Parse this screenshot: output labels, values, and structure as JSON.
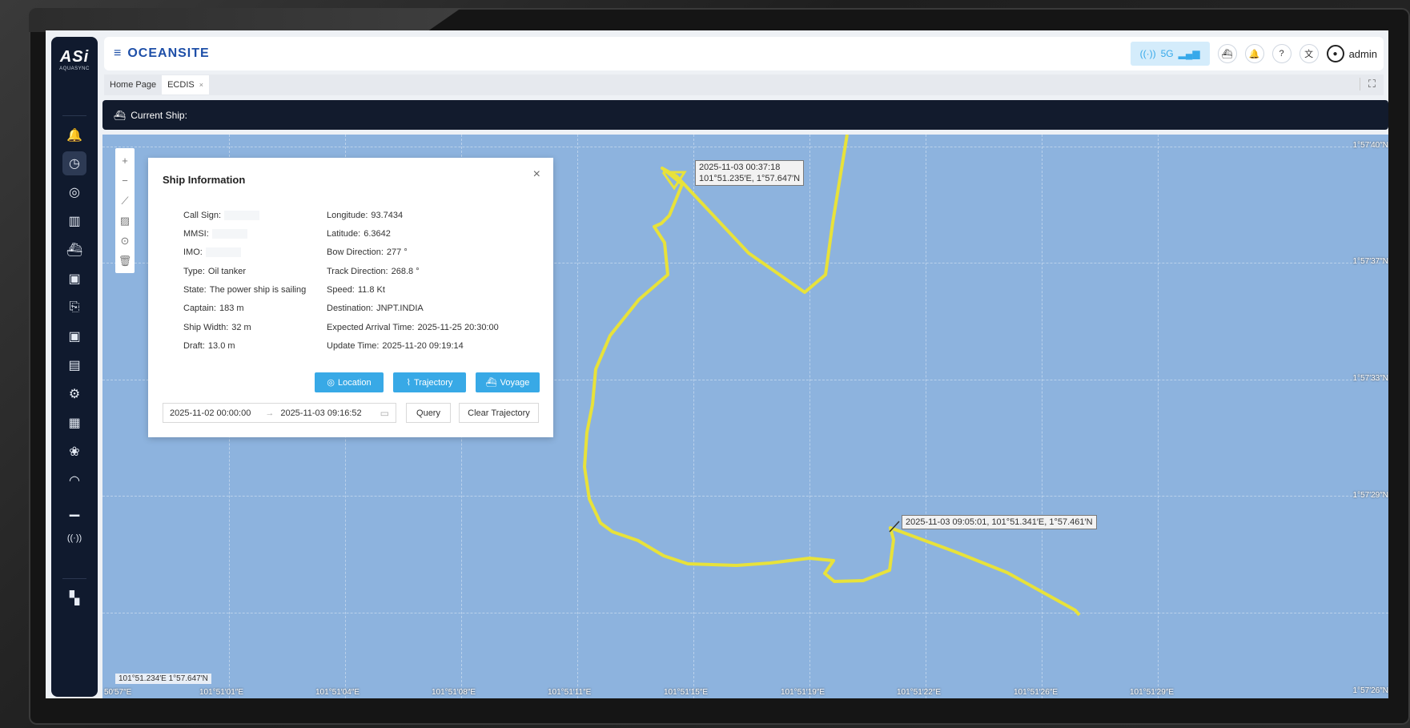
{
  "app": {
    "logo_main": "ASi",
    "logo_sub": "AQUASYNC",
    "brand": "OCEANSITE",
    "menu_icon": "≡",
    "network": {
      "label": "5G",
      "icon": "signal-broadcast-icon"
    },
    "user": {
      "name": "admin"
    }
  },
  "sidebar": {
    "items": [
      {
        "name": "alarm-bell",
        "glyph": "🔔"
      },
      {
        "name": "dashboard-gauge",
        "glyph": "◷"
      },
      {
        "name": "location-pin",
        "glyph": "◎"
      },
      {
        "name": "data-chart",
        "glyph": "▥"
      },
      {
        "name": "ship",
        "glyph": "⛴"
      },
      {
        "name": "monitor-chart",
        "glyph": "▣"
      },
      {
        "name": "report-export",
        "glyph": "⎘"
      },
      {
        "name": "trend-monitor",
        "glyph": "▣"
      },
      {
        "name": "document-list",
        "glyph": "▤"
      },
      {
        "name": "ship-settings",
        "glyph": "⚙"
      },
      {
        "name": "analysis-board",
        "glyph": "▦"
      },
      {
        "name": "resources",
        "glyph": "❀"
      },
      {
        "name": "speed-gauge",
        "glyph": "◠"
      },
      {
        "name": "statistics-bars",
        "glyph": "▁"
      },
      {
        "name": "broadcast",
        "glyph": "((·))"
      }
    ],
    "bottom_glyph": "▚"
  },
  "tabs": [
    {
      "label": "Home Page"
    },
    {
      "label": "ECDIS",
      "close": "×"
    }
  ],
  "shipbar": {
    "label": "Current Ship:"
  },
  "map": {
    "lat_labels": [
      "1°57′40″N",
      "1°57′37″N",
      "1°57′33″N",
      "1°57′29″N",
      "1°57′26″N"
    ],
    "lon_labels": [
      "50′57″E",
      "101°51′01″E",
      "101°51′04″E",
      "101°51′08″E",
      "101°51′11″E",
      "101°51′15″E",
      "101°51′19″E",
      "101°51′22″E",
      "101°51′26″E",
      "101°51′29″E"
    ],
    "cursor_coord": "101°51.234′E  1°57.647′N",
    "tooltip_start_time": "2025-11-03 00:37:18",
    "tooltip_start_pos": "101°51.235′E, 1°57.647′N",
    "tooltip_end": "2025-11-03 09:05:01, 101°51.341′E, 1°57.461′N",
    "tools": [
      "+",
      "−",
      "⟋",
      "▨",
      "⊙",
      "🗑"
    ],
    "track_color": "#e8e23a"
  },
  "panel": {
    "title": "Ship Information",
    "close": "×",
    "left": [
      {
        "label": "Call Sign:",
        "value": ""
      },
      {
        "label": "MMSI:",
        "value": ""
      },
      {
        "label": "IMO:",
        "value": ""
      },
      {
        "label": "Type:",
        "value": "Oil tanker"
      },
      {
        "label": "State:",
        "value": "The power ship is sailing"
      },
      {
        "label": "Captain:",
        "value": "183 m"
      },
      {
        "label": "Ship Width:",
        "value": "32 m"
      },
      {
        "label": "Draft:",
        "value": "13.0 m"
      }
    ],
    "right": [
      {
        "label": "Longitude:",
        "value": "93.7434"
      },
      {
        "label": "Latitude:",
        "value": "6.3642"
      },
      {
        "label": "Bow Direction:",
        "value": "277 °"
      },
      {
        "label": "Track Direction:",
        "value": "268.8 °"
      },
      {
        "label": "Speed:",
        "value": "11.8 Kt"
      },
      {
        "label": "Destination:",
        "value": "JNPT.INDIA"
      },
      {
        "label": "Expected Arrival Time:",
        "value": "2025-11-25 20:30:00"
      },
      {
        "label": "Update Time:",
        "value": "2025-11-20 09:19:14"
      }
    ],
    "buttons": {
      "location": "Location",
      "trajectory": "Trajectory",
      "voyage": "Voyage",
      "query": "Query",
      "clear": "Clear Trajectory"
    },
    "range_start": "2025-11-02 00:00:00",
    "range_arrow": "→",
    "range_end": "2025-11-03 09:16:52"
  }
}
